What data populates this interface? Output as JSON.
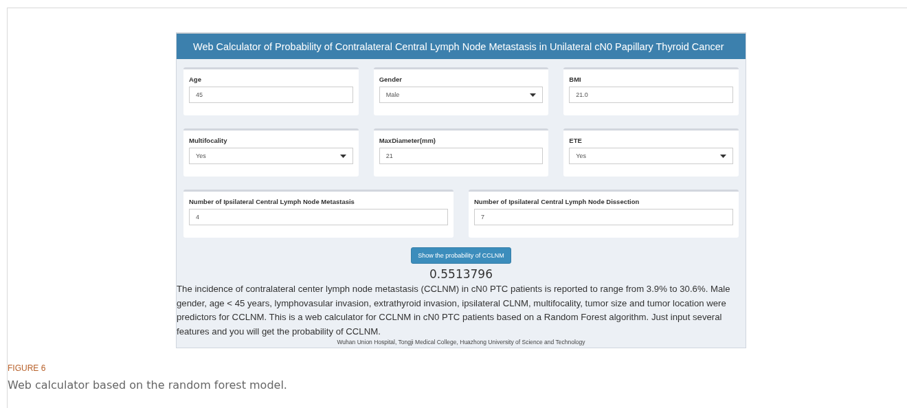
{
  "app": {
    "title": "Web Calculator of Probability of Contralateral Central Lymph Node Metastasis in Unilateral cN0 Papillary Thyroid Cancer",
    "feature_inputs": [
      {
        "label": "Age",
        "kind": "input",
        "value": "45"
      },
      {
        "label": "Gender",
        "kind": "select",
        "value": "Male"
      },
      {
        "label": "BMI",
        "kind": "input",
        "value": "21.0"
      },
      {
        "label": "Multifocality",
        "kind": "select",
        "value": "Yes"
      },
      {
        "label": "MaxDiameter(mm)",
        "kind": "input",
        "value": "21"
      },
      {
        "label": "ETE",
        "kind": "select",
        "value": "Yes"
      }
    ],
    "lymph_node_inputs": [
      {
        "label": "Number of Ipsilateral Central Lymph Node Metastasis",
        "kind": "input",
        "value": "4"
      },
      {
        "label": "Number of Ipsilateral Central Lymph Node Dissection",
        "kind": "input",
        "value": "7"
      }
    ],
    "button": "Show the probability of CCLNM",
    "result": "0.5513796",
    "description": "The incidence of contralateral center lymph node metastasis (CCLNM) in cN0 PTC patients is reported to range from 3.9% to 30.6%. Male gender, age < 45 years, lymphovasular invasion, extrathyroid invasion, ipsilateral CLNM, multifocality, tumor size and tumor location were predictors for CCLNM. This is a web calculator for CCLNM in cN0 PTC patients based on a Random Forest algorithm. Just input several features and you will get the probability of CCLNM.",
    "footer": "Wuhan Union Hospital, Tongji Medical College, Huazhong University of Science and Technology"
  },
  "figure": {
    "label": "FIGURE 6",
    "caption": "Web calculator based on the random forest model."
  }
}
